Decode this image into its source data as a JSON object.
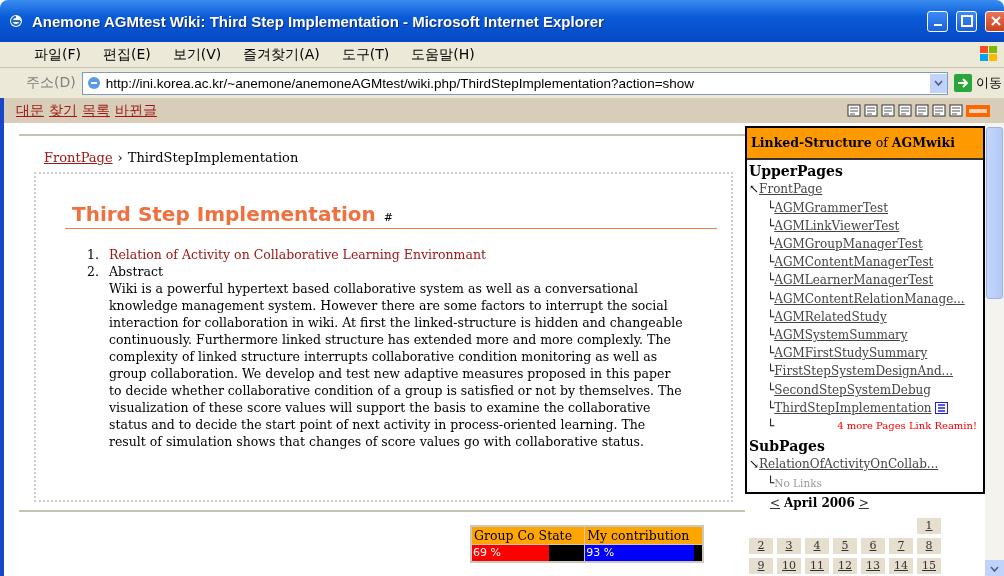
{
  "window": {
    "title": "Anemone AGMtest Wiki: Third Step Implementation - Microsoft Internet Explorer"
  },
  "menu": [
    "파일(F)",
    "편집(E)",
    "보기(V)",
    "즐겨찾기(A)",
    "도구(T)",
    "도움말(H)"
  ],
  "address": {
    "label": "주소(D)",
    "url": "http://ini.korea.ac.kr/~anemone/anemoneAGMtest/wiki.php/ThirdStepImplementation?action=show",
    "go": "이동"
  },
  "wiki_nav": [
    "대문",
    "찾기",
    "목록",
    "바뀐글"
  ],
  "breadcrumb": {
    "link": "FrontPage",
    "separator": "›",
    "current": "ThirdStepImplementation"
  },
  "heading": {
    "title": "Third Step Implementation",
    "anchor": "#"
  },
  "list": [
    {
      "number": "1.",
      "kind": "link",
      "text": "Relation of Activity on Collaborative Learning Environmant"
    },
    {
      "number": "2.",
      "kind": "section",
      "text": "Abstract",
      "body": "Wiki is a powerful hypertext based collaborative system as well as a conversational knowledge management system. However there are some factors to interrupt the social interaction for collaboration in wiki. At first the linked-structure is hidden and changeable continuously. Furthermore linked structure has extended more and more complexly. The complexity of linked structure interrupts collaborative condition monitoring as well as group collaboration. We develop and test new adaptive measures proposed in this paper to decide whether collaborative condition of a group is satisfied or not by themselves. The visualization of these score values will support the basis to examine the collaborative status and to decide the start point of next activity in process-oriented learning. The result of simulation shows that changes of score values go with collaborative status."
    }
  ],
  "status_table": {
    "columns": [
      "Group Co State",
      "My contribution"
    ],
    "bars": [
      {
        "reading": "69 %",
        "level": 0.69,
        "color": "#ff0000"
      },
      {
        "reading": "93 %",
        "level": 0.93,
        "color": "#0000ff"
      }
    ]
  },
  "sidebar": {
    "title": "**Linked-Structure** of **AGMwiki**",
    "sections": [
      {
        "heading": "UpperPages",
        "marker": "↖",
        "root": "FrontPage",
        "children": [
          {
            "branch": "└",
            "text": "AGMGrammerTest",
            "current": false
          },
          {
            "branch": "└",
            "text": "AGMLinkViewerTest",
            "current": false
          },
          {
            "branch": "└",
            "text": "AGMGroupManagerTest",
            "current": false
          },
          {
            "branch": "└",
            "text": "AGMContentManagerTest",
            "current": false
          },
          {
            "branch": "└",
            "text": "AGMLearnerManagerTest",
            "current": false
          },
          {
            "branch": "└",
            "text": "AGMContentRelationManage...",
            "current": false
          },
          {
            "branch": "└",
            "text": "AGMRelatedStudy",
            "current": false
          },
          {
            "branch": "└",
            "text": "AGMSystemSummary",
            "current": false
          },
          {
            "branch": "└",
            "text": "AGMFirstStudySummary",
            "current": false
          },
          {
            "branch": "└",
            "text": "FirstStepSystemDesignAnd...",
            "current": false
          },
          {
            "branch": "└",
            "text": "SecondStepSystemDebug",
            "current": false
          },
          {
            "branch": "└",
            "text": "ThirdStepImplementation",
            "current": true
          }
        ],
        "more": {
          "branch": "└",
          "note": "4 more Pages Link Reamin!"
        }
      },
      {
        "heading": "SubPages",
        "marker": "↘",
        "root": "RelationOfActivityOnCollab...",
        "empty": {
          "branch": "└",
          "note": "No Links"
        }
      }
    ]
  },
  "calendar": {
    "prev": "<",
    "title": "April 2006",
    "next": ">",
    "weeks": [
      [
        "1"
      ],
      [
        "2",
        "3",
        "4",
        "5",
        "6",
        "7",
        "8"
      ],
      [
        "9",
        "10",
        "11",
        "12",
        "13",
        "14",
        "15"
      ]
    ]
  }
}
